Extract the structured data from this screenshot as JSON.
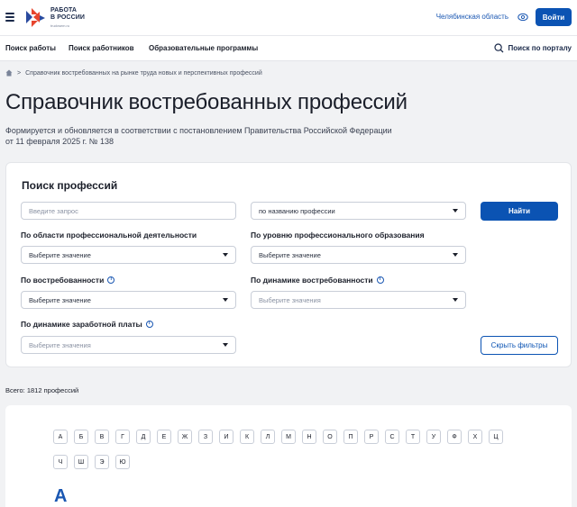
{
  "header": {
    "logo_line1": "РАБОТА",
    "logo_line2": "В РОССИИ",
    "logo_sub": "trudvsem.ru",
    "region": "Челябинская область",
    "login_label": "Войти",
    "icons": {
      "menu": "burger-icon",
      "eye": "eye-icon",
      "logo": "logo-icon"
    }
  },
  "nav": {
    "items": [
      "Поиск работы",
      "Поиск работников",
      "Образовательные программы"
    ],
    "portal_search": "Поиск по порталу"
  },
  "breadcrumb": {
    "separator": ">",
    "current": "Справочник востребованных на рынке труда новых и перспективных профессий"
  },
  "page": {
    "title": "Справочник востребованных профессий",
    "description": "Формируется и обновляется в соответствии с постановлением Правительства Российской Федерации от 11 февраля 2025 г. № 138"
  },
  "search": {
    "title": "Поиск профессий",
    "query_placeholder": "Введите запрос",
    "mode_value": "по названию профессии",
    "find_label": "Найти",
    "filters": [
      {
        "label": "По области профессиональной деятельности",
        "value": "Выберите значение"
      },
      {
        "label": "По уровню профессионального образования",
        "value": "Выберите значение"
      },
      {
        "label": "По востребованности",
        "value": "Выберите значение"
      },
      {
        "label": "По динамике востребованности",
        "value": "Выберите значения"
      },
      {
        "label": "По динамике заработной платы",
        "value": "Выберите значения"
      }
    ],
    "info_glyph": "i",
    "hide_filters_label": "Скрыть фильтры"
  },
  "results": {
    "total": "Всего: 1812 профессий"
  },
  "alphabet": {
    "letters": [
      "А",
      "Б",
      "В",
      "Г",
      "Д",
      "Е",
      "Ж",
      "З",
      "И",
      "К",
      "Л",
      "М",
      "Н",
      "О",
      "П",
      "Р",
      "С",
      "Т",
      "У",
      "Ф",
      "Х",
      "Ц",
      "Ч",
      "Ш",
      "Э",
      "Ю"
    ],
    "current_letter": "А"
  },
  "colors": {
    "primary": "#0b53b3",
    "link": "#1a57b2",
    "background": "#f1f2f4"
  }
}
